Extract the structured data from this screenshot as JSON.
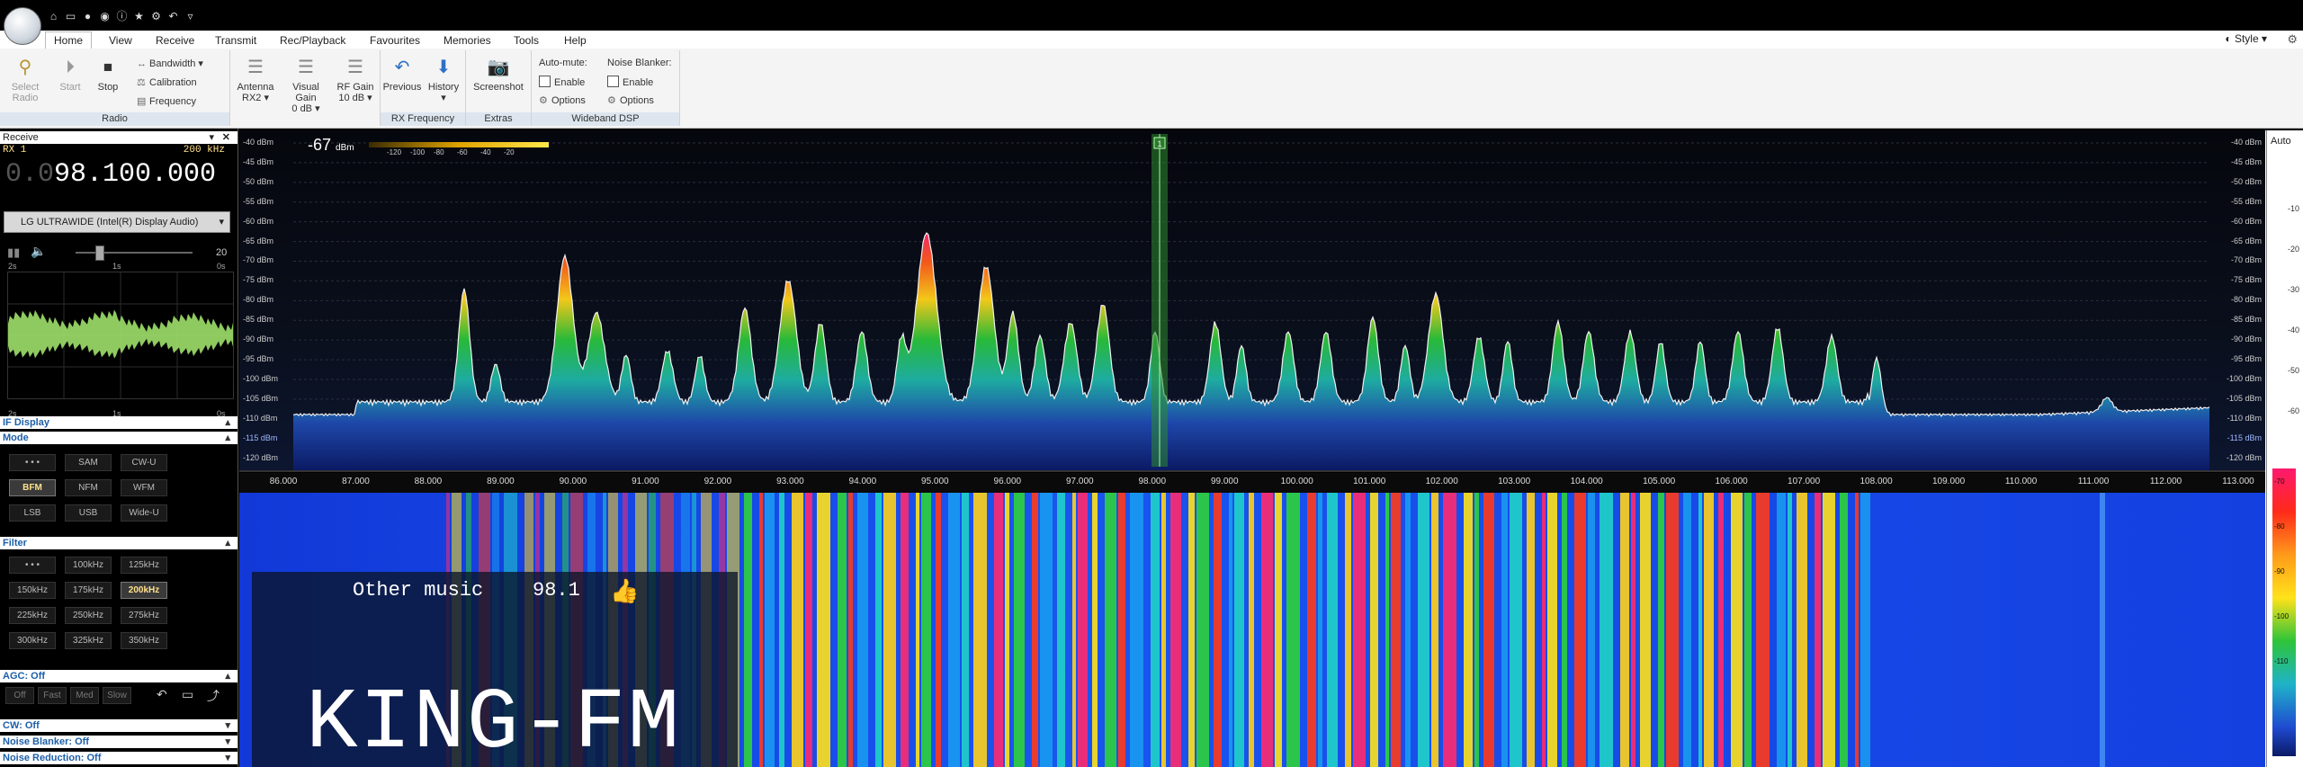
{
  "quick_access": {
    "icons": [
      "home-icon",
      "folder-icon",
      "record-icon",
      "stop-circle-icon",
      "info-icon",
      "star-icon",
      "settings-icon",
      "undo-icon",
      "more-icon"
    ]
  },
  "tabs": [
    "Home",
    "View",
    "Receive",
    "Transmit",
    "Rec/Playback",
    "Favourites",
    "Memories",
    "Tools",
    "Help"
  ],
  "style_label": "Style",
  "ribbon": {
    "radio_group": "Radio",
    "select_radio": "Select\nRadio",
    "start": "Start",
    "stop": "Stop",
    "bandwidth": "Bandwidth",
    "calibration": "Calibration",
    "frequency": "Frequency",
    "antenna": "Antenna",
    "antenna_val": "RX2",
    "visual_gain": "Visual Gain",
    "visual_gain_val": "0 dB",
    "rf_gain": "RF Gain",
    "rf_gain_val": "10 dB",
    "rx_freq_group": "RX Frequency",
    "previous": "Previous",
    "history": "History",
    "extras_group": "Extras",
    "screenshot": "Screenshot",
    "wideband_group": "Wideband DSP",
    "automute": "Auto-mute:",
    "noise_blanker": "Noise Blanker:",
    "enable": "Enable",
    "options": "Options"
  },
  "left": {
    "receive": "Receive",
    "rx": "RX 1",
    "bw": "200 kHz",
    "freq_dim": "0.0",
    "freq": "98.100.000",
    "audio_device": "LG ULTRAWIDE (Intel(R) Display Audio)",
    "volume": "20",
    "scope_labels_top": [
      "2s",
      "1s",
      "0s"
    ],
    "scope_labels_bot": [
      "2s",
      "1s",
      "0s"
    ],
    "if_display": "IF Display",
    "mode": "Mode",
    "modes": [
      "• • •",
      "SAM",
      "CW-U",
      "BFM",
      "NFM",
      "WFM",
      "LSB",
      "USB",
      "Wide-U"
    ],
    "selected_mode": "BFM",
    "filter": "Filter",
    "filters": [
      "• • •",
      "100kHz",
      "125kHz",
      "150kHz",
      "175kHz",
      "200kHz",
      "225kHz",
      "250kHz",
      "275kHz",
      "300kHz",
      "325kHz",
      "350kHz"
    ],
    "selected_filter": "200kHz",
    "agc": "AGC: Off",
    "agc_btns": [
      "Off",
      "Fast",
      "Med",
      "Slow"
    ],
    "cw": "CW: Off",
    "nb": "Noise Blanker: Off",
    "nr": "Noise Reduction: Off"
  },
  "spectrum": {
    "level_readout": "-67",
    "level_unit": "dBm",
    "scale_labels": [
      "-120",
      "-100",
      "-80",
      "-60",
      "-40",
      "-20"
    ],
    "db_labels": [
      "-40 dBm",
      "-45 dBm",
      "-50 dBm",
      "-55 dBm",
      "-60 dBm",
      "-65 dBm",
      "-70 dBm",
      "-75 dBm",
      "-80 dBm",
      "-85 dBm",
      "-90 dBm",
      "-95 dBm",
      "-100 dBm",
      "-105 dBm",
      "-110 dBm",
      "-115 dBm",
      "-120 dBm"
    ],
    "freq_labels": [
      "86.000",
      "87.000",
      "88.000",
      "89.000",
      "90.000",
      "91.000",
      "92.000",
      "93.000",
      "94.000",
      "95.000",
      "96.000",
      "97.000",
      "98.000",
      "99.000",
      "100.000",
      "101.000",
      "102.000",
      "103.000",
      "104.000",
      "105.000",
      "106.000",
      "107.000",
      "108.000",
      "109.000",
      "110.000",
      "111.000",
      "112.000",
      "113.000"
    ],
    "marker": "1",
    "auto": "Auto",
    "right_scale": [
      "-10",
      "-20",
      "-30",
      "-40",
      "-50",
      "-60"
    ],
    "color_scale": [
      "-70",
      "-80",
      "-90",
      "-100",
      "-110"
    ]
  },
  "rds": {
    "genre": "Other music",
    "freq": "98.1",
    "station": "KING-FM"
  },
  "colors": {
    "ribbon_bg": "#f4f4f4",
    "group_label": "#dde6ef",
    "panel_header": "#1d5ea8",
    "accent": "#ffe08a"
  }
}
